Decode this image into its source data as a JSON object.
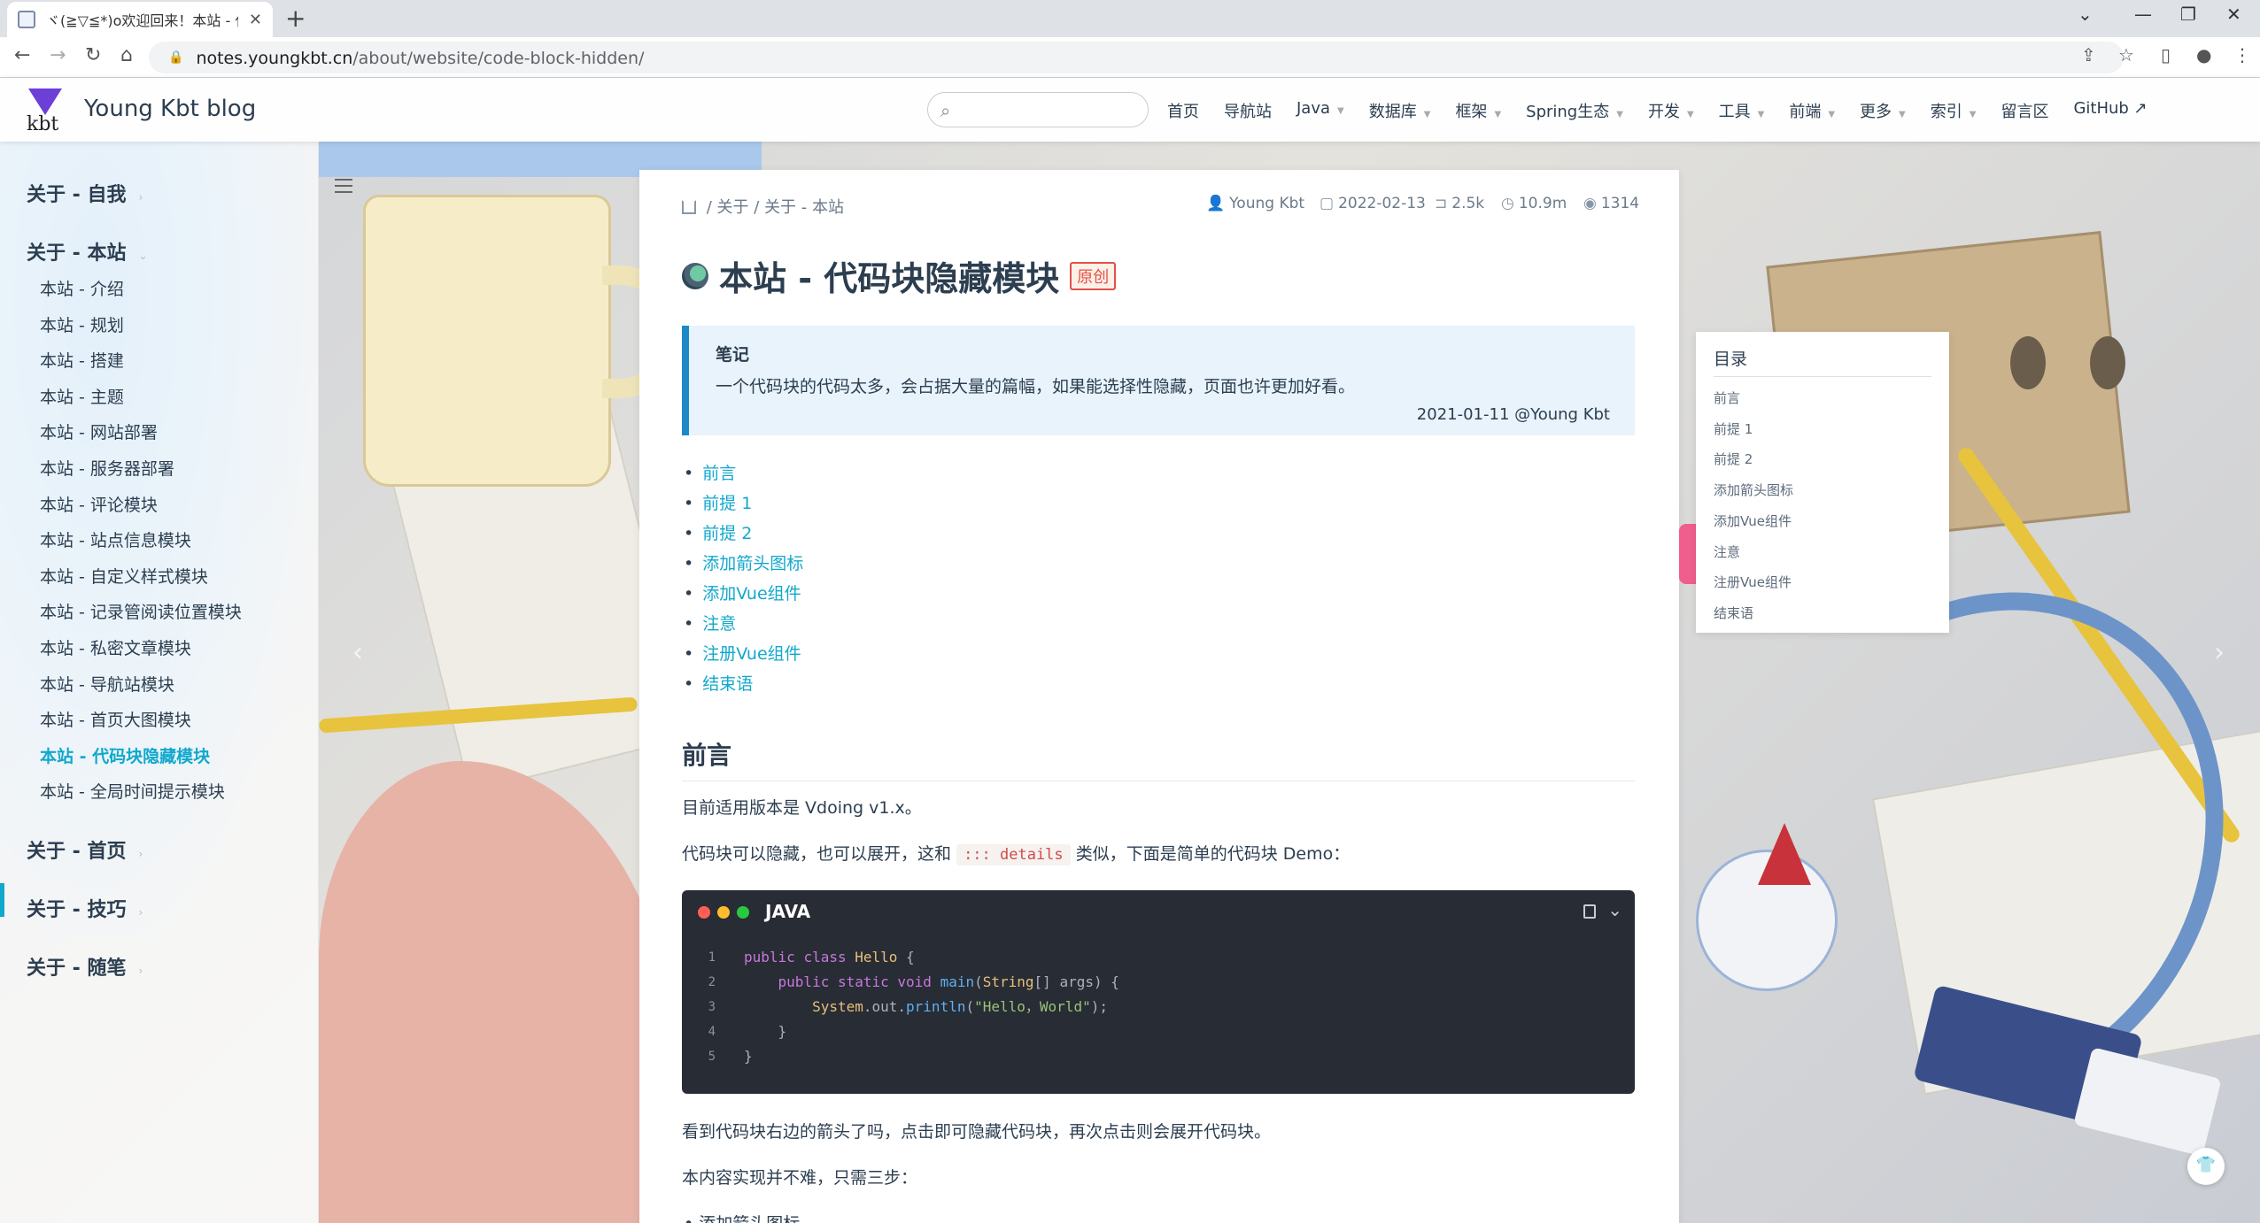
{
  "browser": {
    "tab_title": "ヾ(≧▽≦*)o欢迎回来！本站 - 代码",
    "new_tab": "+",
    "url_host": "notes.youngkbt.cn",
    "url_path": "/about/website/code-block-hidden/"
  },
  "site": {
    "logo_text": "kbt",
    "name": "Young Kbt blog",
    "search_placeholder": "",
    "nav": [
      {
        "label": "首页",
        "dropdown": false
      },
      {
        "label": "导航站",
        "dropdown": false
      },
      {
        "label": "Java",
        "dropdown": true
      },
      {
        "label": "数据库",
        "dropdown": true
      },
      {
        "label": "框架",
        "dropdown": true
      },
      {
        "label": "Spring生态",
        "dropdown": true
      },
      {
        "label": "开发",
        "dropdown": true
      },
      {
        "label": "工具",
        "dropdown": true
      },
      {
        "label": "前端",
        "dropdown": true
      },
      {
        "label": "更多",
        "dropdown": true
      },
      {
        "label": "索引",
        "dropdown": true
      },
      {
        "label": "留言区",
        "dropdown": false
      },
      {
        "label": "GitHub ↗",
        "dropdown": false
      }
    ]
  },
  "sidebar": {
    "groups": [
      {
        "label": "关于 - 自我"
      },
      {
        "label": "关于 - 本站"
      },
      {
        "label": "关于 - 首页"
      },
      {
        "label": "关于 - 技巧"
      },
      {
        "label": "关于 - 随笔"
      }
    ],
    "items": [
      "本站 - 介绍",
      "本站 - 规划",
      "本站 - 搭建",
      "本站 - 主题",
      "本站 - 网站部署",
      "本站 - 服务器部署",
      "本站 - 评论模块",
      "本站 - 站点信息模块",
      "本站 - 自定义样式模块",
      "本站 - 记录管阅读位置模块",
      "本站 - 私密文章模块",
      "本站 - 导航站模块",
      "本站 - 首页大图模块",
      "本站 - 代码块隐藏模块",
      "本站 - 全局时间提示模块"
    ],
    "active_index": 13
  },
  "article": {
    "breadcrumb": [
      "关于",
      "关于 - 本站"
    ],
    "author": "Young Kbt",
    "date": "2022-02-13",
    "words": "2.5k",
    "read_time": "10.9m",
    "views": "1314",
    "title": "本站 - 代码块隐藏模块",
    "badge": "原创",
    "note": {
      "title": "笔记",
      "text": "一个代码块的代码太多，会占据大量的篇幅，如果能选择性隐藏，页面也许更加好看。",
      "sign": "2021-01-11 @Young Kbt"
    },
    "toc": [
      "前言",
      "前提 1",
      "前提 2",
      "添加箭头图标",
      "添加Vue组件",
      "注意",
      "注册Vue组件",
      "结束语"
    ],
    "section_title": "前言",
    "p1": "目前适用版本是 Vdoing v1.x。",
    "p2_before": "代码块可以隐藏，也可以展开，这和",
    "p2_code": "::: details",
    "p2_after": "类似，下面是简单的代码块 Demo：",
    "code_lang": "JAVA",
    "line_numbers": [
      "1",
      "2",
      "3",
      "4",
      "5"
    ],
    "p3": "看到代码块右边的箭头了吗，点击即可隐藏代码块，再次点击则会展开代码块。",
    "p4": "本内容实现并不难，只需三步：",
    "p5": "• 添加箭头图标"
  },
  "right_toc": {
    "title": "目录",
    "items": [
      "前言",
      "前提 1",
      "前提 2",
      "添加箭头图标",
      "添加Vue组件",
      "注意",
      "注册Vue组件",
      "结束语"
    ]
  },
  "colors": {
    "accent": "#11a8cd",
    "code_bg": "#282c34",
    "dot_red": "#ff5f56",
    "dot_yellow": "#ffbd2e",
    "dot_green": "#27c93f"
  }
}
